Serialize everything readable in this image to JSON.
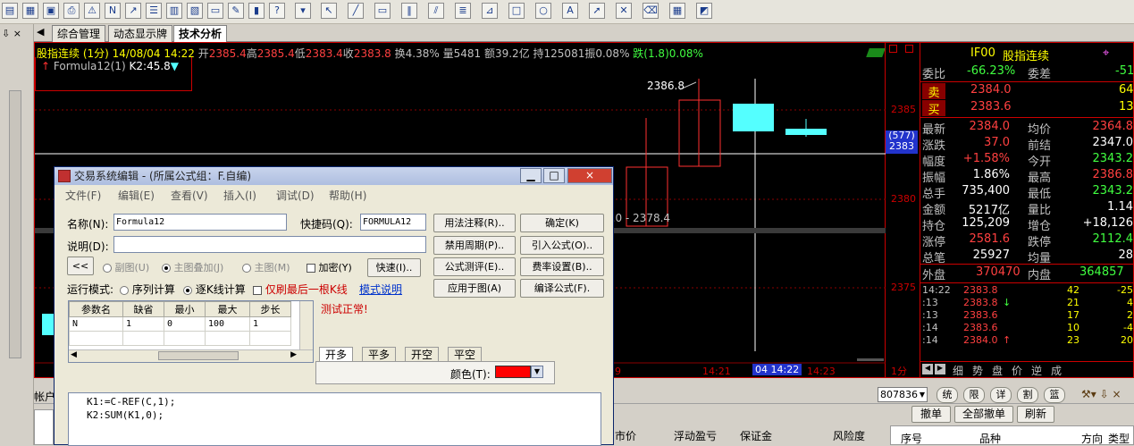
{
  "toolbar": {
    "icons": [
      "new-window-icon",
      "layout-icon",
      "open-icon",
      "print-icon",
      "alert-icon",
      "news-icon",
      "chart-icon",
      "list-icon",
      "bar-icon",
      "stock-icon",
      "monitor-icon",
      "note-icon",
      "briefcase-icon",
      "help-icon",
      "more-icon",
      "draw-cursor-icon",
      "draw-line-icon",
      "draw-rect-icon",
      "draw-lines-icon",
      "draw-channel-icon",
      "draw-fib-icon",
      "draw-gann-icon",
      "draw-box-icon",
      "draw-ellipse-icon",
      "draw-text-icon",
      "draw-arrow-icon",
      "draw-delete-icon",
      "draw-erase-icon",
      "grid-icon",
      "color-icon"
    ]
  },
  "tabs": [
    {
      "label": "综合管理"
    },
    {
      "label": "动态显示牌"
    },
    {
      "label": "技术分析"
    }
  ],
  "chart": {
    "header_name": "股指连续 (1分) 14/08/04 14:22",
    "open_label": "开",
    "open": "2385.4",
    "high_label": "高",
    "high": "2385.4",
    "low_label": "低",
    "low": "2383.4",
    "close_label": "收",
    "close": "2383.8",
    "turnover": "换4.38%",
    "volume": "量5481",
    "amount": "额39.2亿",
    "holding": "持125081",
    "amplitude": "振0.08%",
    "change": "跌(1.8)0.08%",
    "formula_line": "Formula12(1)",
    "k2": "K2:45.8",
    "peak_label": "2386.8",
    "range_label": "3.0 - 2378.4",
    "time_labels": [
      "9",
      "14:21",
      "04 14:22",
      "14:23"
    ],
    "period": "1分",
    "colors": {
      "up": "#ff3030",
      "down": "#54ffff",
      "text": "#c0c0c0",
      "yellow": "#ffff00",
      "grid": "#8a0000"
    }
  },
  "axis": {
    "labels": [
      "2385",
      "2380",
      "2375"
    ],
    "current_a": "(577)",
    "current_b": "2383"
  },
  "quote": {
    "symbol": "IF00",
    "name": "股指连续",
    "weibi_label": "委比",
    "weibi": "-66.23%",
    "weicha_label": "委差",
    "weicha": "-51",
    "sell_label": "卖",
    "sell_price": "2384.0",
    "sell_vol": "64",
    "buy_label": "买",
    "buy_price": "2383.6",
    "buy_vol": "13",
    "rows": [
      {
        "l1": "最新",
        "v1": "2384.0",
        "l2": "均价",
        "v2": "2364.8",
        "c1": "#ff4040",
        "c2": "#ff4040"
      },
      {
        "l1": "涨跌",
        "v1": "37.0",
        "l2": "前结",
        "v2": "2347.0",
        "c1": "#ff4040",
        "c2": "#ffffff"
      },
      {
        "l1": "幅度",
        "v1": "+1.58%",
        "l2": "今开",
        "v2": "2343.2",
        "c1": "#ff4040",
        "c2": "#40ff40"
      },
      {
        "l1": "振幅",
        "v1": "1.86%",
        "l2": "最高",
        "v2": "2386.8",
        "c1": "#ffffff",
        "c2": "#ff4040"
      },
      {
        "l1": "总手",
        "v1": "735,400",
        "l2": "最低",
        "v2": "2343.2",
        "c1": "#ffffff",
        "c2": "#40ff40"
      },
      {
        "l1": "金额",
        "v1": "5217亿",
        "l2": "量比",
        "v2": "1.14",
        "c1": "#ffffff",
        "c2": "#ffffff"
      },
      {
        "l1": "持仓",
        "v1": "125,209",
        "l2": "增仓",
        "v2": "+18,126",
        "c1": "#ffffff",
        "c2": "#ffffff"
      },
      {
        "l1": "涨停",
        "v1": "2581.6",
        "l2": "跌停",
        "v2": "2112.4",
        "c1": "#ff4040",
        "c2": "#40ff40"
      },
      {
        "l1": "总笔",
        "v1": "25927",
        "l2": "均量",
        "v2": "28",
        "c1": "#ffffff",
        "c2": "#ffffff"
      }
    ],
    "outer_label": "外盘",
    "outer": "370470",
    "inner_label": "内盘",
    "inner": "364857",
    "ticks": [
      {
        "t": "14:22",
        "p": "2383.8",
        "arrow": "",
        "v": "42",
        "d": "-25"
      },
      {
        "t": ":13",
        "p": "2383.8",
        "arrow": "↓",
        "v": "21",
        "d": "4"
      },
      {
        "t": ":13",
        "p": "2383.6",
        "arrow": "",
        "v": "17",
        "d": "2"
      },
      {
        "t": ":14",
        "p": "2383.6",
        "arrow": "",
        "v": "10",
        "d": "-4"
      },
      {
        "t": ":14",
        "p": "2384.0",
        "arrow": "↑",
        "v": "23",
        "d": "20"
      }
    ],
    "bottom_tabs": [
      "细",
      "势",
      "盘",
      "价",
      "逆",
      "成"
    ]
  },
  "dialog": {
    "title": "交易系统编辑 - (所属公式组：F.自编)",
    "menu": [
      "文件(F)",
      "编辑(E)",
      "查看(V)",
      "插入(I)",
      "调试(D)",
      "帮助(H)"
    ],
    "name_label": "名称(N):",
    "name_value": "Formula12",
    "shortcut_label": "快捷码(Q):",
    "shortcut_value": "FORMULA12",
    "desc_label": "说明(D):",
    "desc_value": "",
    "back_btn": "<<",
    "opt_sub": "副图(U)",
    "opt_main_overlay": "主图叠加(J)",
    "opt_main": "主图(M)",
    "encrypt": "加密(Y)",
    "fast_btn": "快速(I)..",
    "mode_label": "运行模式:",
    "mode_seq": "序列计算",
    "mode_bar": "逐K线计算",
    "last_bar_only": "仅刷最后一根K线",
    "mode_help": "模式说明",
    "status": "测试正常!",
    "buttons": {
      "usage": "用法注释(R)..",
      "ok": "确定(K)",
      "disable": "禁用周期(P)..",
      "import": "引入公式(O)..",
      "test": "公式测评(E)..",
      "fee": "费率设置(B)..",
      "apply": "应用于图(A)",
      "compile": "编译公式(F)."
    },
    "param_headers": [
      "参数名",
      "缺省",
      "最小",
      "最大",
      "步长"
    ],
    "params": [
      {
        "name": "N",
        "def": "1",
        "min": "0",
        "max": "100",
        "step": "1"
      }
    ],
    "subtabs": [
      "开多",
      "平多",
      "开空",
      "平空"
    ],
    "color_label": "颜色(T):",
    "color_value": "#ff0000",
    "code_lines": [
      "K1:=C-REF(C,1);",
      "K2:SUM(K1,0);"
    ]
  },
  "bottom": {
    "account_label": "帐户",
    "account_select": "807836",
    "buttons": [
      "统",
      "限",
      "详",
      "割",
      "篮"
    ],
    "actions": [
      "撤单",
      "全部撤单",
      "刷新"
    ],
    "cols_left": [
      "市价",
      "浮动盈亏",
      "保证金",
      "风险度"
    ],
    "cols_right": [
      "序号",
      "品种",
      "方向",
      "类型"
    ]
  }
}
